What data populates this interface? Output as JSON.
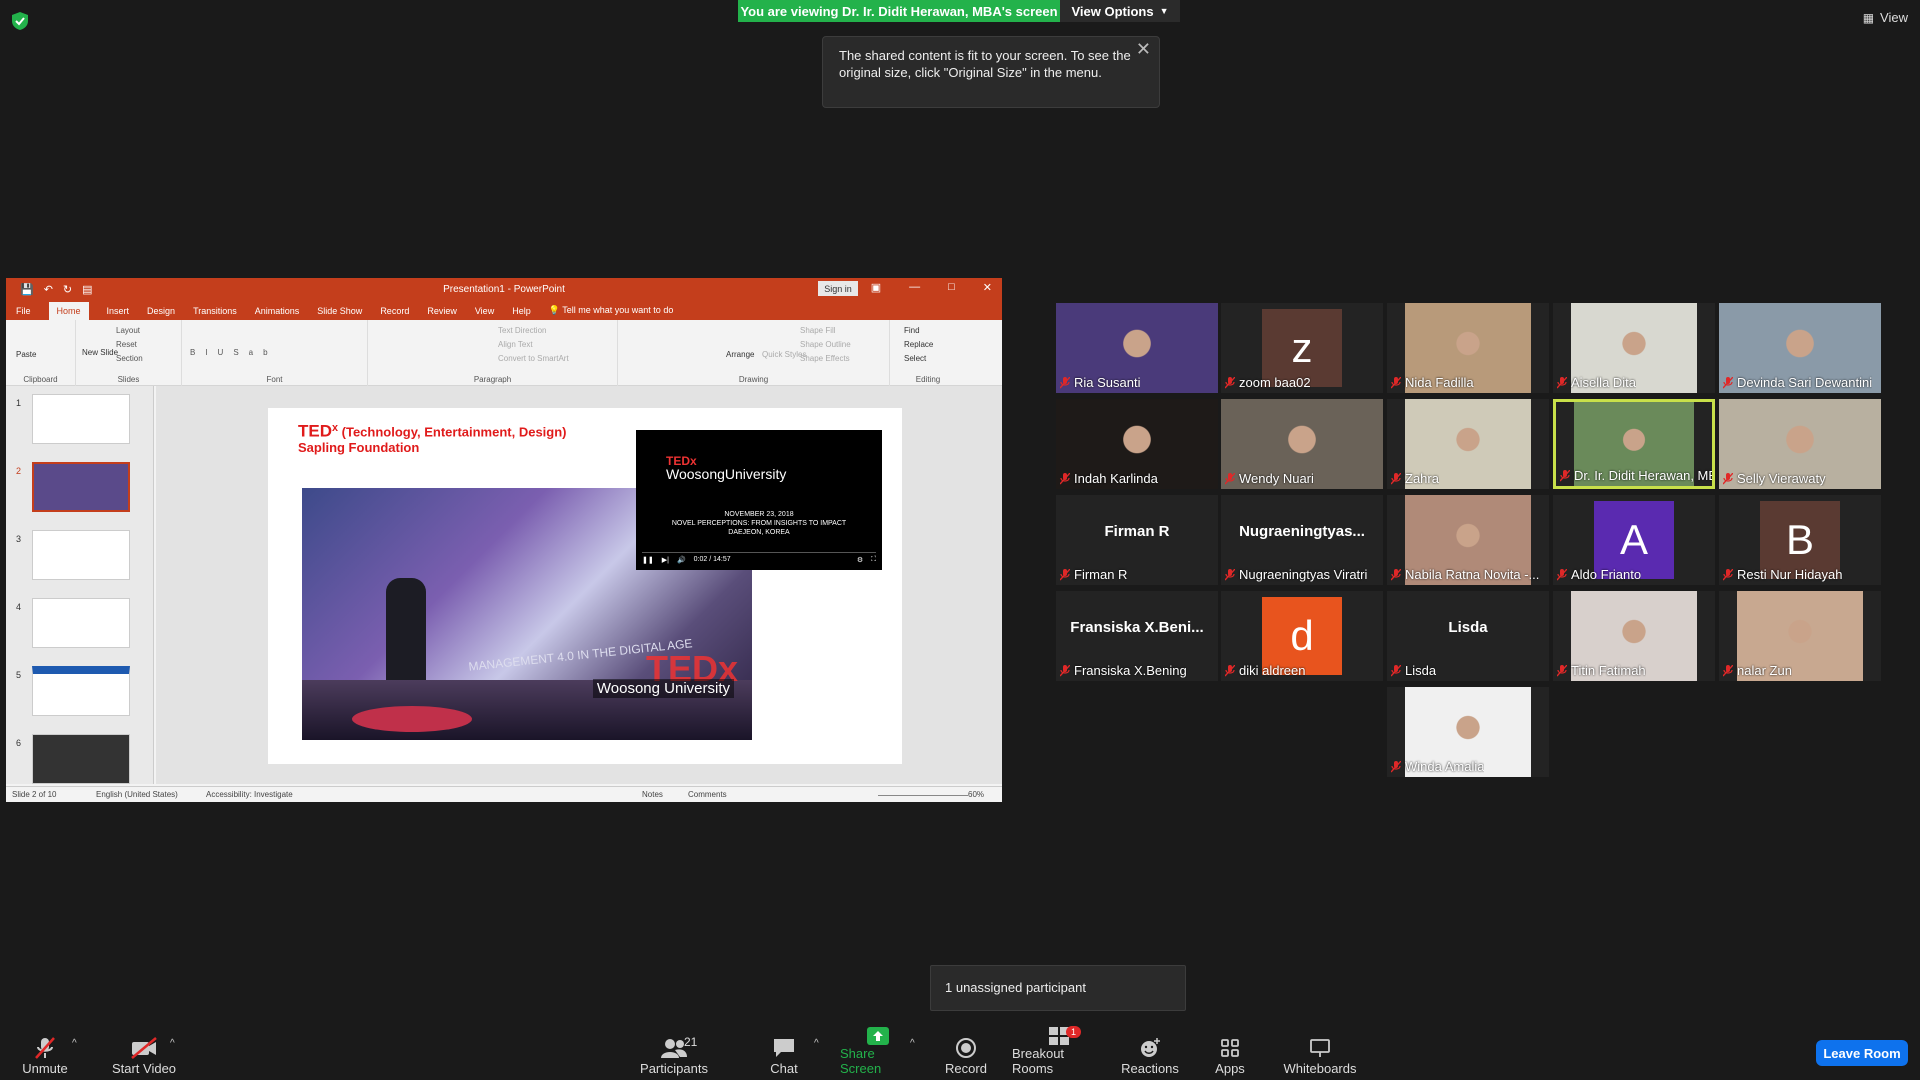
{
  "header": {
    "share_banner": "You are viewing Dr. Ir. Didit Herawan, MBA's screen",
    "view_options": "View Options",
    "view": "View",
    "tooltip": "The shared content is fit to your screen. To see the original size, click \"Original Size\" in the menu."
  },
  "ppt": {
    "window_title": "Presentation1 - PowerPoint",
    "sign_in": "Sign in",
    "tabs": [
      "File",
      "Home",
      "Insert",
      "Design",
      "Transitions",
      "Animations",
      "Slide Show",
      "Record",
      "Review",
      "View",
      "Help",
      "Tell me what you want to do"
    ],
    "ribbon": {
      "paste": "Paste",
      "clipboard": "Clipboard",
      "new_slide": "New Slide",
      "layout": "Layout",
      "reset": "Reset",
      "section": "Section",
      "slides": "Slides",
      "font": "Font",
      "text_direction": "Text Direction",
      "align_text": "Align Text",
      "convert_smartart": "Convert to SmartArt",
      "paragraph": "Paragraph",
      "arrange": "Arrange",
      "quick_styles": "Quick Styles",
      "shape_fill": "Shape Fill",
      "shape_outline": "Shape Outline",
      "shape_effects": "Shape Effects",
      "drawing": "Drawing",
      "find": "Find",
      "replace": "Replace",
      "select": "Select",
      "editing": "Editing"
    },
    "thumb_numbers": [
      "1",
      "2",
      "3",
      "4",
      "5",
      "6"
    ],
    "slide": {
      "tedx": "TED",
      "x": "x",
      "title_rest": " (Technology, Entertainment, Design)",
      "subtitle": "Sapling Foundation",
      "screen_text": "MANAGEMENT 4.0 IN THE DIGITAL AGE",
      "photo_logo": "TEDx",
      "photo_caption": "Woosong University",
      "video_tedx": "TEDx",
      "video_title": "WoosongUniversity",
      "video_line1": "NOVEMBER 23, 2018",
      "video_line2": "NOVEL PERCEPTIONS: FROM INSIGHTS TO IMPACT",
      "video_line3": "DAEJEON, KOREA",
      "video_time": "0:02 / 14:57"
    },
    "status": {
      "slide_of": "Slide 2 of 10",
      "language": "English (United States)",
      "accessibility": "Accessibility: Investigate",
      "notes": "Notes",
      "comments": "Comments",
      "zoom": "60%"
    }
  },
  "participants": [
    {
      "name": "Ria Susanti",
      "kind": "video",
      "color": "#4a3a7a"
    },
    {
      "name": "zoom baa02",
      "kind": "avatar",
      "letter": "z",
      "color": "#5a3a32"
    },
    {
      "name": "Nida Fadilla",
      "kind": "video",
      "color": "#b89a7a"
    },
    {
      "name": "Aisella Dita",
      "kind": "video",
      "color": "#d8d8d0"
    },
    {
      "name": "Devinda Sari Dewantini",
      "kind": "video",
      "color": "#8a9aa8"
    },
    {
      "name": "Indah Karlinda",
      "kind": "video",
      "color": "#1e1a18"
    },
    {
      "name": "Wendy Nuari",
      "kind": "video",
      "color": "#6a6258"
    },
    {
      "name": "Zahra",
      "kind": "video",
      "color": "#cfcab8"
    },
    {
      "name": "Dr. Ir. Didit Herawan, MBA",
      "kind": "video",
      "color": "#6a8a5a"
    },
    {
      "name": "Selly Vierawaty",
      "kind": "video",
      "color": "#b8b0a0"
    },
    {
      "name": "Firman R",
      "kind": "text",
      "big": "Firman R"
    },
    {
      "name": "Nugraeningtyas Viratri",
      "kind": "text",
      "big": "Nugraeningtyas..."
    },
    {
      "name": "Nabila Ratna Novita -...",
      "kind": "video",
      "color": "#b08a78"
    },
    {
      "name": "Aldo Frianto",
      "kind": "avatar",
      "letter": "A",
      "color": "#5a2ab0"
    },
    {
      "name": "Resti Nur Hidayah",
      "kind": "avatar",
      "letter": "B",
      "color": "#5a3a32"
    },
    {
      "name": "Fransiska X.Bening",
      "kind": "text",
      "big": "Fransiska  X.Beni..."
    },
    {
      "name": "diki aldreen",
      "kind": "avatar",
      "letter": "d",
      "color": "#e8541e"
    },
    {
      "name": "Lisda",
      "kind": "text",
      "big": "Lisda"
    },
    {
      "name": "Titin Fatimah",
      "kind": "video",
      "color": "#d8d0cc"
    },
    {
      "name": "nalar Zun",
      "kind": "video",
      "color": "#c8a890"
    },
    {
      "name": "Winda Amalia",
      "kind": "video",
      "color": "#f0f0f0"
    }
  ],
  "unassigned": "1 unassigned participant",
  "toolbar": {
    "unmute": "Unmute",
    "start_video": "Start Video",
    "participants": "Participants",
    "participants_count": "21",
    "chat": "Chat",
    "share_screen": "Share Screen",
    "record": "Record",
    "breakout_rooms": "Breakout Rooms",
    "breakout_badge": "1",
    "reactions": "Reactions",
    "apps": "Apps",
    "whiteboards": "Whiteboards",
    "leave_room": "Leave Room"
  },
  "colors": {
    "share_green": "#23b24b",
    "ppt_red": "#c43e1c",
    "leave_blue": "#0e72ed",
    "active_speaker": "#c8e04a",
    "mute_red": "#e02828"
  }
}
